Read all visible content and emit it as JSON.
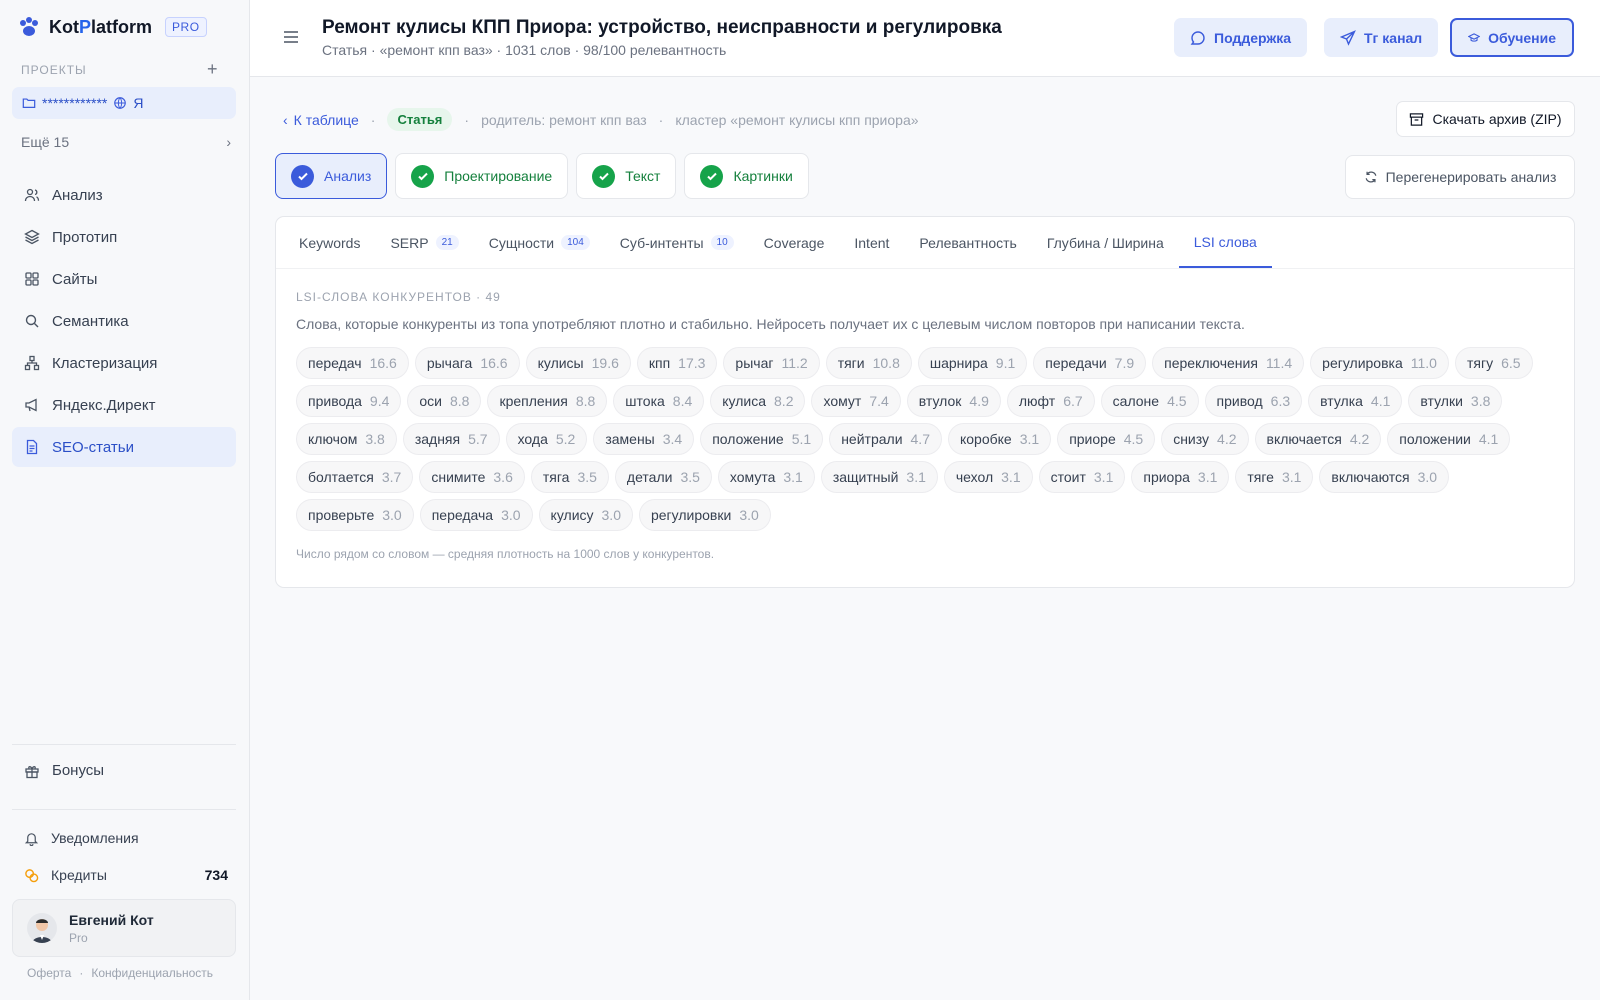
{
  "app": {
    "name_a": "Kot",
    "name_b": "P",
    "name_c": "latform",
    "badge": "PRO"
  },
  "sidebar": {
    "projects_title": "ПРОЕКТЫ",
    "project": {
      "name": "************",
      "suffix": "Я"
    },
    "more": "Ещё 15",
    "nav": [
      {
        "label": "Анализ",
        "icon": "users-icon"
      },
      {
        "label": "Прототип",
        "icon": "layers-icon"
      },
      {
        "label": "Сайты",
        "icon": "grid-icon"
      },
      {
        "label": "Семантика",
        "icon": "search-icon"
      },
      {
        "label": "Кластеризация",
        "icon": "cluster-icon"
      },
      {
        "label": "Яндекс.Директ",
        "icon": "megaphone-icon"
      },
      {
        "label": "SEO-статьи",
        "icon": "document-icon"
      }
    ],
    "bonus": "Бонусы",
    "notifications": "Уведомления",
    "credits_label": "Кредиты",
    "credits_value": "734",
    "user_name": "Евгений Кот",
    "user_plan": "Pro",
    "offer": "Оферта",
    "privacy": "Конфиденциальность"
  },
  "header": {
    "title": "Ремонт кулисы КПП Приора: устройство, неисправности и регулировка",
    "subtitle": "Статья · «ремонт кпп ваз» · 1031 слов · 98/100 релевантность",
    "support": "Поддержка",
    "tg": "Тг канал",
    "edu": "Обучение"
  },
  "crumbs": {
    "back": "К таблице",
    "tag": "Статья",
    "parent": "родитель: ремонт кпп ваз",
    "cluster": "кластер «ремонт кулисы кпп приора»",
    "zip": "Скачать архив (ZIP)"
  },
  "steps": [
    "Анализ",
    "Проектирование",
    "Текст",
    "Картинки"
  ],
  "regen": "Перегенерировать анализ",
  "tabs": [
    {
      "label": "Keywords",
      "badge": ""
    },
    {
      "label": "SERP",
      "badge": "21"
    },
    {
      "label": "Сущности",
      "badge": "104"
    },
    {
      "label": "Суб-интенты",
      "badge": "10"
    },
    {
      "label": "Coverage",
      "badge": ""
    },
    {
      "label": "Intent",
      "badge": ""
    },
    {
      "label": "Релевантность",
      "badge": ""
    },
    {
      "label": "Глубина / Ширина",
      "badge": ""
    },
    {
      "label": "LSI слова",
      "badge": ""
    }
  ],
  "lsi": {
    "title": "LSI-СЛОВА КОНКУРЕНТОВ · 49",
    "desc": "Слова, которые конкуренты из топа употребляют плотно и стабильно. Нейросеть получает их с целевым числом повторов при написании текста.",
    "note": "Число рядом со словом — средняя плотность на 1000 слов у конкурентов.",
    "words": [
      [
        "передач",
        "16.6"
      ],
      [
        "рычага",
        "16.6"
      ],
      [
        "кулисы",
        "19.6"
      ],
      [
        "кпп",
        "17.3"
      ],
      [
        "рычаг",
        "11.2"
      ],
      [
        "тяги",
        "10.8"
      ],
      [
        "шарнира",
        "9.1"
      ],
      [
        "передачи",
        "7.9"
      ],
      [
        "переключения",
        "11.4"
      ],
      [
        "регулировка",
        "11.0"
      ],
      [
        "тягу",
        "6.5"
      ],
      [
        "привода",
        "9.4"
      ],
      [
        "оси",
        "8.8"
      ],
      [
        "крепления",
        "8.8"
      ],
      [
        "штока",
        "8.4"
      ],
      [
        "кулиса",
        "8.2"
      ],
      [
        "хомут",
        "7.4"
      ],
      [
        "втулок",
        "4.9"
      ],
      [
        "люфт",
        "6.7"
      ],
      [
        "салоне",
        "4.5"
      ],
      [
        "привод",
        "6.3"
      ],
      [
        "втулка",
        "4.1"
      ],
      [
        "втулки",
        "3.8"
      ],
      [
        "ключом",
        "3.8"
      ],
      [
        "задняя",
        "5.7"
      ],
      [
        "хода",
        "5.2"
      ],
      [
        "замены",
        "3.4"
      ],
      [
        "положение",
        "5.1"
      ],
      [
        "нейтрали",
        "4.7"
      ],
      [
        "коробке",
        "3.1"
      ],
      [
        "приоре",
        "4.5"
      ],
      [
        "снизу",
        "4.2"
      ],
      [
        "включается",
        "4.2"
      ],
      [
        "положении",
        "4.1"
      ],
      [
        "болтается",
        "3.7"
      ],
      [
        "снимите",
        "3.6"
      ],
      [
        "тяга",
        "3.5"
      ],
      [
        "детали",
        "3.5"
      ],
      [
        "хомута",
        "3.1"
      ],
      [
        "защитный",
        "3.1"
      ],
      [
        "чехол",
        "3.1"
      ],
      [
        "стоит",
        "3.1"
      ],
      [
        "приора",
        "3.1"
      ],
      [
        "тяге",
        "3.1"
      ],
      [
        "включаются",
        "3.0"
      ],
      [
        "проверьте",
        "3.0"
      ],
      [
        "передача",
        "3.0"
      ],
      [
        "кулису",
        "3.0"
      ],
      [
        "регулировки",
        "3.0"
      ]
    ]
  }
}
